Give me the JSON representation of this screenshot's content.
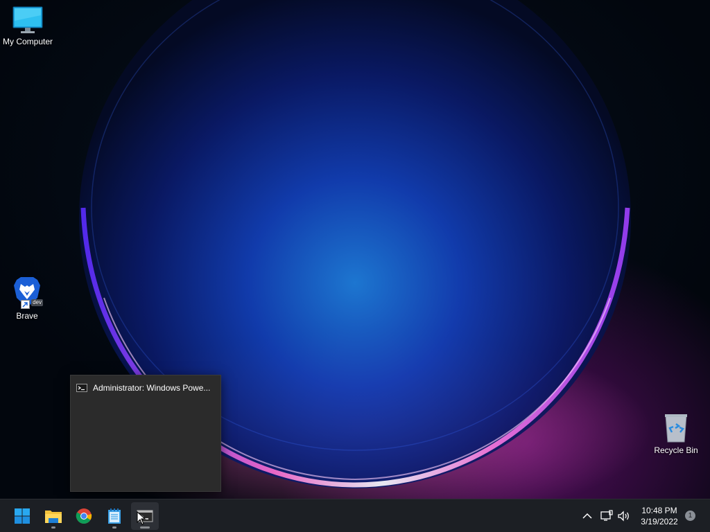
{
  "desktop": {
    "icons": [
      {
        "label": "My Computer"
      },
      {
        "label": "Brave"
      },
      {
        "label": "Recycle Bin"
      }
    ],
    "brave_badge": "dev"
  },
  "thumbnail_popup": {
    "title": "Administrator: Windows Powe..."
  },
  "taskbar": {
    "items": [
      {
        "name": "Start",
        "icon": "windows-logo-icon"
      },
      {
        "name": "File Explorer",
        "icon": "folder-icon",
        "running": true
      },
      {
        "name": "Google Chrome",
        "icon": "chrome-icon",
        "running": false
      },
      {
        "name": "Notepad",
        "icon": "notepad-icon",
        "running": true
      },
      {
        "name": "Windows PowerShell",
        "icon": "terminal-icon",
        "running": true,
        "active": true
      }
    ],
    "tray": {
      "time": "10:48 PM",
      "date": "3/19/2022",
      "notification_count": "1"
    }
  },
  "colors": {
    "taskbar_bg": "#1c1f24",
    "popup_bg": "#2b2b2b",
    "accent_blue": "#0a78d4"
  }
}
